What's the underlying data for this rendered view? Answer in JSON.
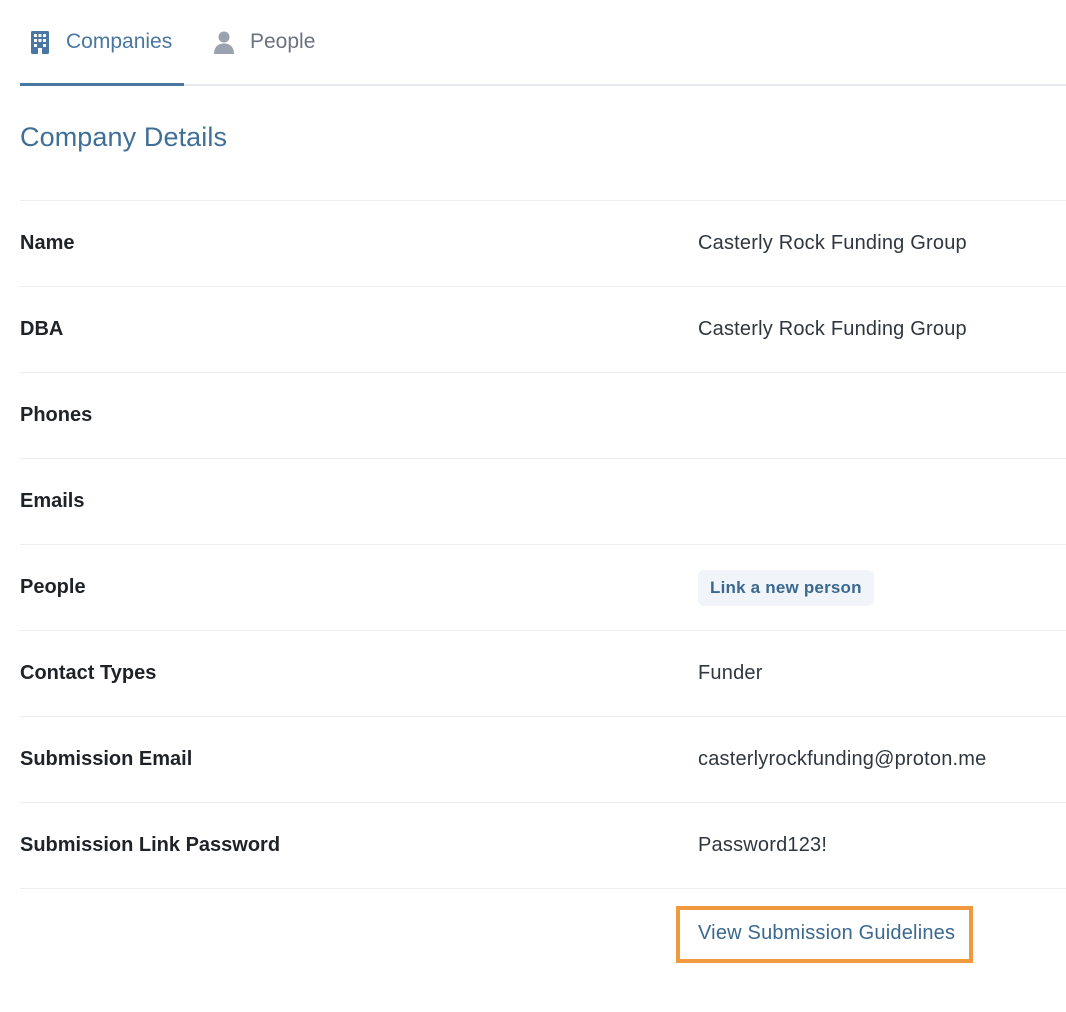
{
  "tabs": [
    {
      "label": "Companies",
      "icon": "building-icon",
      "active": true
    },
    {
      "label": "People",
      "icon": "person-icon",
      "active": false
    }
  ],
  "section": {
    "title": "Company Details"
  },
  "details": [
    {
      "label": "Name",
      "value": "Casterly Rock Funding Group"
    },
    {
      "label": "DBA",
      "value": "Casterly Rock Funding Group"
    },
    {
      "label": "Phones",
      "value": ""
    },
    {
      "label": "Emails",
      "value": ""
    },
    {
      "label": "People",
      "action": "Link a new person"
    },
    {
      "label": "Contact Types",
      "value": "Funder"
    },
    {
      "label": "Submission Email",
      "value": "casterlyrockfunding@proton.me"
    },
    {
      "label": "Submission Link Password",
      "value": "Password123!"
    }
  ],
  "guidelines": {
    "label": "View Submission Guidelines"
  },
  "colors": {
    "accent": "#4a77a1",
    "highlight_border": "#f0993f",
    "button_bg": "#f1f5f9"
  }
}
